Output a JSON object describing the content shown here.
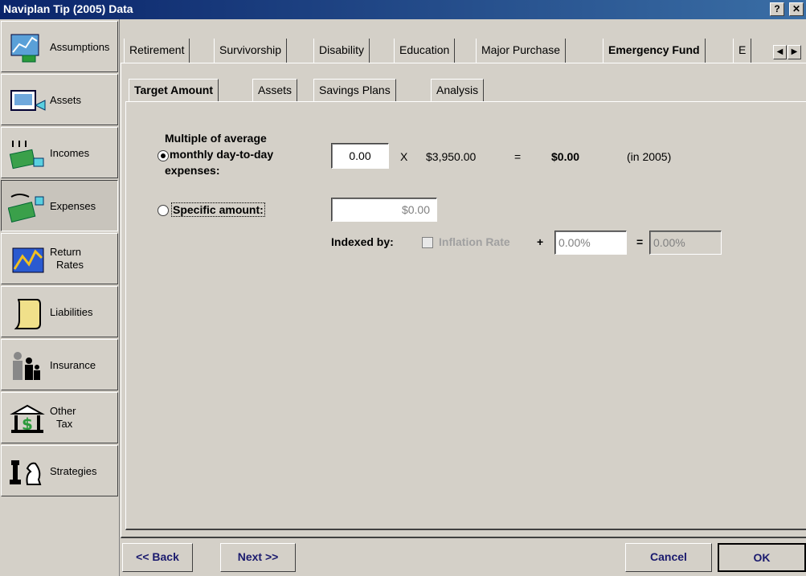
{
  "window": {
    "title": "Naviplan Tip (2005) Data",
    "help_label": "?",
    "close_label": "✕"
  },
  "sidebar": {
    "items": [
      {
        "label": "Assumptions",
        "icon": "assumptions-icon"
      },
      {
        "label": "Assets",
        "icon": "assets-icon"
      },
      {
        "label": "Incomes",
        "icon": "incomes-icon"
      },
      {
        "label": "Expenses",
        "icon": "expenses-icon"
      },
      {
        "label_line1": "Return",
        "label_line2": "Rates",
        "icon": "return-rates-icon"
      },
      {
        "label": "Liabilities",
        "icon": "liabilities-icon"
      },
      {
        "label": "Insurance",
        "icon": "insurance-icon"
      },
      {
        "label_line1": "Other",
        "label_line2": "Tax",
        "icon": "other-tax-icon"
      },
      {
        "label": "Strategies",
        "icon": "strategies-icon"
      }
    ],
    "active_index": 3
  },
  "tabs": [
    "Retirement",
    "Survivorship",
    "Disability",
    "Education",
    "Major Purchase",
    "Emergency Fund",
    "E"
  ],
  "selected_tab": "Emergency Fund",
  "subtabs": [
    "Target Amount",
    "Assets",
    "Savings Plans",
    "Analysis"
  ],
  "selected_subtab": "Target Amount",
  "form": {
    "multiple_label_1": "Multiple of average",
    "multiple_label_2": "monthly day-to-day",
    "multiple_label_3": "expenses:",
    "multiple_value": "0.00",
    "times": "X",
    "monthly_expense": "$3,950.00",
    "equals": "=",
    "result": "$0.00",
    "year_note": "(in 2005)",
    "specific_label": "Specific amount:",
    "specific_value": "$0.00",
    "indexed_by_label": "Indexed by:",
    "inflation_label": "Inflation Rate",
    "plus": "+",
    "inflation_add": "0.00%",
    "equals2": "=",
    "inflation_total": "0.00%"
  },
  "buttons": {
    "back": "<< Back",
    "next": "Next >>",
    "cancel": "Cancel",
    "ok": "OK"
  }
}
